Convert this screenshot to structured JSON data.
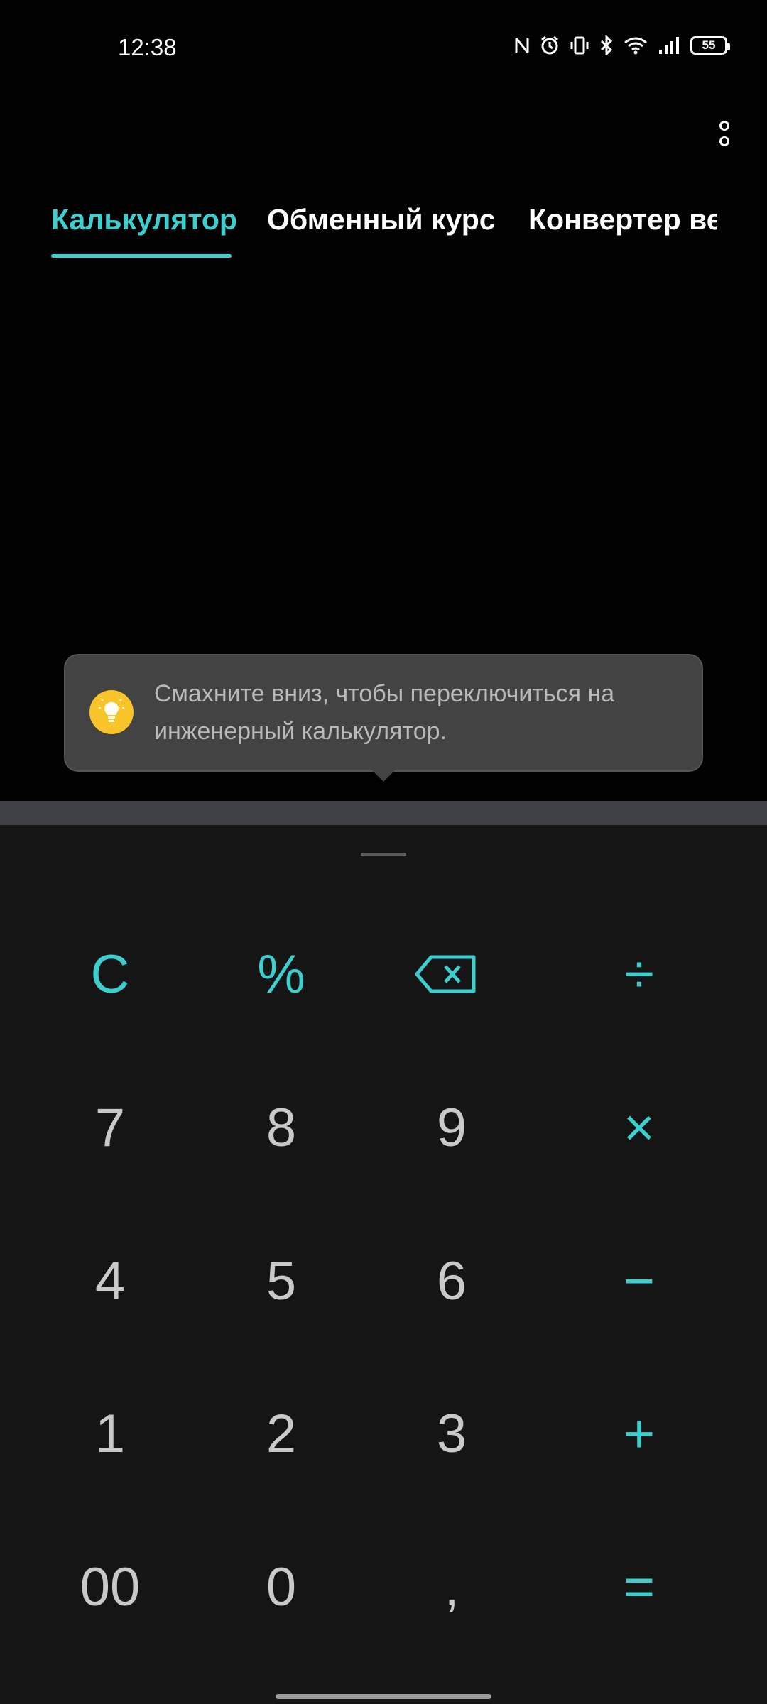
{
  "status_bar": {
    "time": "12:38",
    "battery": "55",
    "icons": [
      "nfc-icon",
      "alarm-icon",
      "vibrate-icon",
      "bluetooth-icon",
      "wifi-icon",
      "signal-icon",
      "battery-icon"
    ]
  },
  "tabs": [
    {
      "label": "Калькулятор",
      "active": true
    },
    {
      "label": "Обменный курс",
      "active": false
    },
    {
      "label": "Конвертер ве",
      "active": false
    }
  ],
  "tooltip": {
    "line1": "Смахните вниз, чтобы переключиться на",
    "line2": "инженерный калькулятор."
  },
  "keypad": {
    "row1": [
      "C",
      "%",
      "backspace",
      "÷"
    ],
    "row2": [
      "7",
      "8",
      "9",
      "×"
    ],
    "row3": [
      "4",
      "5",
      "6",
      "−"
    ],
    "row4": [
      "1",
      "2",
      "3",
      "+"
    ],
    "row5": [
      "00",
      "0",
      ",",
      "="
    ]
  },
  "colors": {
    "accent": "#3dcfd0",
    "keypad_bg": "#151515",
    "digit": "#c9c9c9",
    "bulb": "#f8c42a"
  }
}
